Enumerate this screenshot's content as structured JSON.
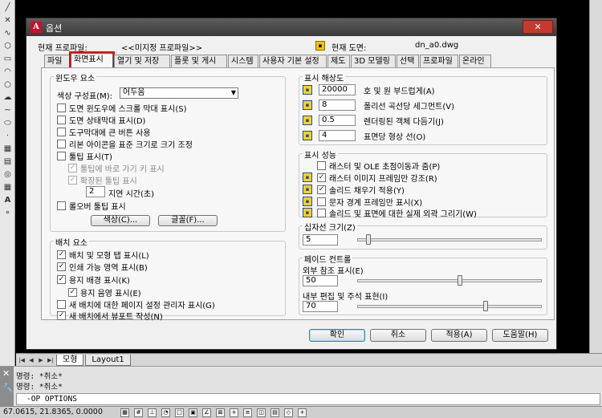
{
  "dialog": {
    "title": "옵션",
    "close_label": "✕",
    "current_profile_label": "현재 프로파일:",
    "current_profile_value": "<<미지정 프로파일>>",
    "current_drawing_label": "현재 도면:",
    "current_drawing_value": "dn_a0.dwg"
  },
  "tabs": [
    "파일",
    "화면표시",
    "열기 및 저장",
    "플롯 및 게시",
    "시스템",
    "사용자 기본 설정",
    "제도",
    "3D 모델링",
    "선택",
    "프로파일",
    "온라인"
  ],
  "window_elements": {
    "title": "윈도우 요소",
    "color_scheme_label": "색상 구성표(M):",
    "color_scheme_value": "어두움",
    "checkboxes": [
      {
        "label": "도면 윈도우에 스크롤 막대 표시(S)",
        "checked": false
      },
      {
        "label": "도면 상태막대 표시(D)",
        "checked": false
      },
      {
        "label": "도구막대에 큰 버튼 사용",
        "checked": false
      },
      {
        "label": "리본 아이콘을 표준 크기로 크기 조정",
        "checked": false
      },
      {
        "label": "툴팁 표시(T)",
        "checked": false
      },
      {
        "label": "툴팁에 바로 가기 키 표시",
        "checked": true
      },
      {
        "label": "확장된 툴팁 표시",
        "checked": true
      }
    ],
    "delay_value": "2",
    "delay_label": "지연 시간(초)",
    "rollover_label": "롤오버 툴팁 표시",
    "colors_button": "색상(C)...",
    "fonts_button": "글꼴(F)..."
  },
  "layout_elements": {
    "title": "배치 요소",
    "checkboxes": [
      {
        "label": "배치 및 모형 탭 표시(L)",
        "checked": true
      },
      {
        "label": "인쇄 가능 영역 표시(B)",
        "checked": true
      },
      {
        "label": "용지 배경 표시(K)",
        "checked": true
      },
      {
        "label": "용지 음영 표시(E)",
        "checked": true
      },
      {
        "label": "새 배치에 대한 페이지 설정 관리자 표시(G)",
        "checked": false
      },
      {
        "label": "새 배치에서 뷰포트 작성(N)",
        "checked": true
      }
    ]
  },
  "display_resolution": {
    "title": "표시 해상도",
    "rows": [
      {
        "value": "20000",
        "label": "호 및 원 부드럽게(A)"
      },
      {
        "value": "8",
        "label": "폴리선 곡선당 세그먼트(V)"
      },
      {
        "value": "0.5",
        "label": "렌더링된 객체 다듬기(J)"
      },
      {
        "value": "4",
        "label": "표면당 형상 선(O)"
      }
    ]
  },
  "display_performance": {
    "title": "표시 성능",
    "rows": [
      {
        "label": "래스터 및 OLE 초점이동과 줌(P)",
        "checked": false
      },
      {
        "label": "래스터 이미지 프레임만 강조(R)",
        "checked": true
      },
      {
        "label": "솔리드 채우기 적용(Y)",
        "checked": true
      },
      {
        "label": "문자 경계 프레임만 표시(X)",
        "checked": false
      },
      {
        "label": "솔리드 및 표면에 대한 실제 외곽 그리기(W)",
        "checked": false
      }
    ]
  },
  "crosshair": {
    "title": "십자선 크기(Z)",
    "value": "5",
    "fraction": 0.05
  },
  "fade": {
    "title": "페이드 컨트롤",
    "xref_label": "외부 참조 표시(E)",
    "xref_value": "50",
    "xref_fraction": 0.56,
    "inplace_label": "내부 편집 및 주석 표현(I)",
    "inplace_value": "70",
    "inplace_fraction": 0.7
  },
  "buttons": {
    "ok": "확인",
    "cancel": "취소",
    "apply": "적용(A)",
    "help": "도움말(H)"
  },
  "cad": {
    "tab_model": "모형",
    "tab_layout": "Layout1",
    "cmd_line_1": "명령: *취소*",
    "cmd_line_2": "명령: *취소*",
    "cmd_input": "-OP OPTIONS",
    "coords": "67.0615, 21.8365, 0.0000"
  }
}
